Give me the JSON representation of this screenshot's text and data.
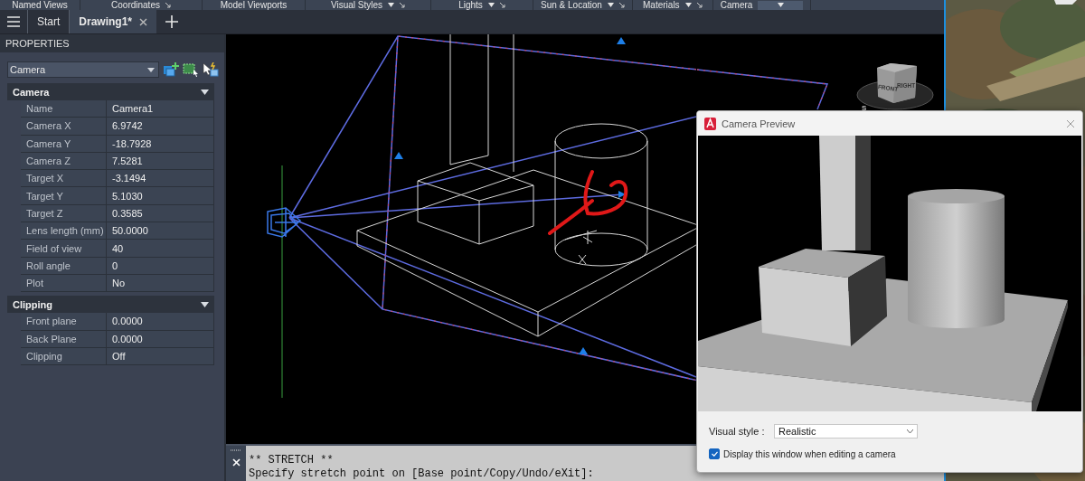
{
  "ribbon_panels": [
    {
      "label": "Named Views",
      "kind": "label",
      "menu": false,
      "launcher": false
    },
    {
      "label": "Coordinates",
      "kind": "label",
      "menu": false,
      "launcher": true
    },
    {
      "label": "Model Viewports",
      "kind": "label",
      "menu": false,
      "launcher": false
    },
    {
      "label": "Visual Styles",
      "kind": "label",
      "menu": true,
      "launcher": true
    },
    {
      "label": "Lights",
      "kind": "label",
      "menu": true,
      "launcher": true
    },
    {
      "label": "Sun & Location",
      "kind": "label",
      "menu": true,
      "launcher": true
    },
    {
      "label": "Materials",
      "kind": "label",
      "menu": true,
      "launcher": true
    },
    {
      "label": "Camera",
      "kind": "combo"
    }
  ],
  "tabs": [
    {
      "label": "Start",
      "selected": false,
      "closable": false
    },
    {
      "label": "Drawing1*",
      "selected": true,
      "closable": true
    }
  ],
  "properties": {
    "title": "PROPERTIES",
    "object_type": "Camera",
    "sections": [
      {
        "title": "Camera",
        "expanded": true,
        "rows": [
          {
            "name": "Name",
            "value": "Camera1"
          },
          {
            "name": "Camera X",
            "value": "6.9742"
          },
          {
            "name": "Camera Y",
            "value": "-18.7928"
          },
          {
            "name": "Camera Z",
            "value": "7.5281"
          },
          {
            "name": "Target X",
            "value": "-3.1494"
          },
          {
            "name": "Target Y",
            "value": "5.1030"
          },
          {
            "name": "Target Z",
            "value": "0.3585"
          },
          {
            "name": "Lens length (mm)",
            "value": "50.0000"
          },
          {
            "name": "Field of view",
            "value": "40"
          },
          {
            "name": "Roll angle",
            "value": "0"
          },
          {
            "name": "Plot",
            "value": "No"
          }
        ]
      },
      {
        "title": "Clipping",
        "expanded": true,
        "rows": [
          {
            "name": "Front plane",
            "value": "0.0000"
          },
          {
            "name": "Back Plane",
            "value": "0.0000"
          },
          {
            "name": "Clipping",
            "value": "Off"
          }
        ]
      }
    ]
  },
  "viewcube": {
    "faces": [
      "FRONT",
      "RIGHT"
    ],
    "compass": [
      "S"
    ]
  },
  "command_line": {
    "lines": [
      "** STRETCH **",
      "Specify stretch point on [Base point/Copy/Undo/eXit]:"
    ]
  },
  "dialog": {
    "title": "Camera Preview",
    "visual_style": {
      "label": "Visual style :",
      "value": "Realistic"
    },
    "checkbox": {
      "label": "Display this window when editing a camera",
      "checked": true
    }
  }
}
